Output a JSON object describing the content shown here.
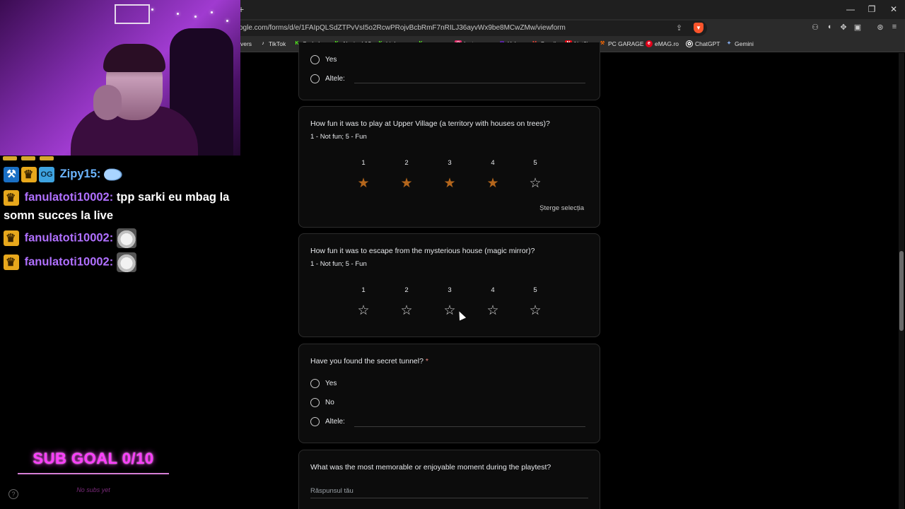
{
  "browser": {
    "url": "ogle.com/forms/d/e/1FAIpQLSdZTPvVsI5o2RcwPRojvBcbRmF7nRILJ36ayvWx9be8MCwZMw/viewform",
    "new_tab_icon": "plus-icon",
    "bookmarks": [
      {
        "label": "vers",
        "icon": ""
      },
      {
        "label": "TikTok",
        "icon": "tiktok-icon",
        "color": "#ffffff"
      },
      {
        "label": "Sarkales",
        "icon": "kick-icon",
        "color": "#53fc18"
      },
      {
        "label": "Alysia_k12",
        "icon": "kick-icon",
        "color": "#53fc18"
      },
      {
        "label": "highman",
        "icon": "kick-icon",
        "color": "#53fc18"
      },
      {
        "label": "roxanne",
        "icon": "kick-icon",
        "color": "#53fc18"
      },
      {
        "label": "Instagram",
        "icon": "instagram-icon",
        "color": "#e1306c"
      },
      {
        "label": "Yahoo",
        "icon": "yahoo-icon",
        "color": "#7e1fff"
      },
      {
        "label": "Gmail",
        "icon": "gmail-icon",
        "color": "#ea4335"
      },
      {
        "label": "Netflix",
        "icon": "netflix-icon",
        "color": "#e50914"
      },
      {
        "label": "PC GARAGE",
        "icon": "pcgarage-icon",
        "color": "#ff6a00"
      },
      {
        "label": "eMAG.ro",
        "icon": "emag-icon",
        "color": "#e2001a"
      },
      {
        "label": "ChatGPT",
        "icon": "chatgpt-icon",
        "color": "#ffffff"
      },
      {
        "label": "Gemini",
        "icon": "gemini-icon",
        "color": "#8ab4f8"
      }
    ]
  },
  "stream": {
    "chat": [
      {
        "user": "Zipy15:",
        "text": "",
        "emote": "wing-emote"
      },
      {
        "user": "fanulatoti10002:",
        "text": "tpp sarki eu mbag la",
        "text2": "somn succes la live"
      },
      {
        "user": "fanulatoti10002:",
        "text": "",
        "emote": "cat-emote"
      },
      {
        "user": "fanulatoti10002:",
        "text": "",
        "emote": "cat-emote"
      }
    ],
    "sub_goal": "SUB GOAL 0/10",
    "sub_goal_note": "No subs yet"
  },
  "form": {
    "prev_question": {
      "options": [
        "Yes",
        "Altele:"
      ]
    },
    "q_upper_village": {
      "title": "How fun it was to play at Upper Village (a territory with houses on trees)?",
      "subtitle": "1 - Not fun; 5 - Fun",
      "scale": [
        "1",
        "2",
        "3",
        "4",
        "5"
      ],
      "rating": 4,
      "clear_label": "Șterge selecția"
    },
    "q_mysterious_house": {
      "title": "How fun it was to escape from the mysterious house (magic mirror)?",
      "subtitle": "1 - Not fun; 5 - Fun",
      "scale": [
        "1",
        "2",
        "3",
        "4",
        "5"
      ],
      "rating": 0
    },
    "q_secret_tunnel": {
      "title": "Have you found the secret tunnel?",
      "required_mark": "*",
      "options": [
        "Yes",
        "No",
        "Altele:"
      ]
    },
    "q_memorable": {
      "title": "What was the most memorable or enjoyable moment during the playtest?",
      "placeholder": "Răspunsul tău"
    }
  },
  "colors": {
    "star_filled": "#b4661c",
    "required": "#f28b82",
    "sub_goal": "#ff3dff"
  }
}
